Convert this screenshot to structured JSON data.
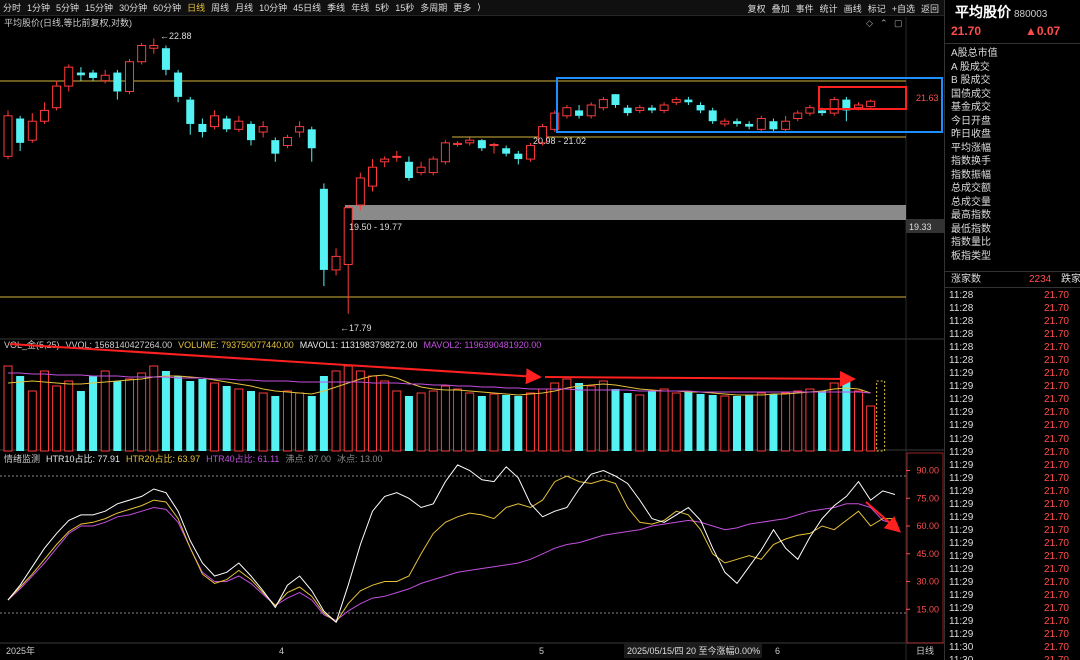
{
  "toolbar": {
    "periods": [
      "分时",
      "1分钟",
      "5分钟",
      "15分钟",
      "30分钟",
      "60分钟",
      "日线",
      "周线",
      "月线",
      "10分钟",
      "45日线",
      "季线",
      "年线",
      "5秒",
      "15秒",
      "多周期",
      "更多"
    ],
    "active_period": "日线",
    "right_items": [
      "复权",
      "叠加",
      "事件",
      "统计",
      "画线",
      "标记",
      "+自选",
      "返回"
    ]
  },
  "main_chart": {
    "title": "平均股价(日线,等比前复权,对数)",
    "labels": {
      "high": "22.88",
      "low": "17.79",
      "zone1": "20.98 - 21.02",
      "zone2": "19.50 - 19.77",
      "right_price1": "21.63",
      "right_price2": "19.33"
    }
  },
  "volume_panel": {
    "title": "VOL_金(5,25)",
    "vvol": "VVOL: 1568140427264.00",
    "volume": "VOLUME: 793750077440.00",
    "mavol1": "MAVOL1: 1131983798272.00",
    "mavol2": "MAVOL2: 1196390481920.00"
  },
  "sentiment_panel": {
    "title": "情绪监测",
    "htr10": "HTR10占比: 77.91",
    "htr20": "HTR20占比: 63.97",
    "htr40": "HTR40占比: 61.11",
    "boil": "沸点: 87.00",
    "freeze": "冰点: 13.00",
    "axis": [
      "90.00",
      "75.00",
      "60.00",
      "45.00",
      "30.00",
      "15.00"
    ]
  },
  "bottom_axis": {
    "labels": [
      "2025年",
      "4",
      "5",
      "6"
    ],
    "status": "2025/05/15/四 20 至今涨幅0.00%",
    "period": "日线"
  },
  "right_panel": {
    "name": "平均股价",
    "code": "880003",
    "price": "21.70",
    "change": "▲0.07",
    "fields": [
      "A股总市值",
      "A 股成交",
      "B 股成交",
      "国债成交",
      "基金成交",
      "今日开盘",
      "昨日收盘",
      "平均涨幅",
      "指数换手",
      "指数振幅",
      "总成交额",
      "总成交量",
      "最高指数",
      "最低指数",
      "指数量比",
      "板指类型"
    ],
    "up_label": "涨家数",
    "up_count": "2234",
    "down_label": "跌家",
    "ticks": [
      {
        "time": "11:28",
        "price": "21.70"
      },
      {
        "time": "11:28",
        "price": "21.70"
      },
      {
        "time": "11:28",
        "price": "21.70"
      },
      {
        "time": "11:28",
        "price": "21.70"
      },
      {
        "time": "11:28",
        "price": "21.70"
      },
      {
        "time": "11:28",
        "price": "21.70"
      },
      {
        "time": "11:29",
        "price": "21.70"
      },
      {
        "time": "11:29",
        "price": "21.70"
      },
      {
        "time": "11:29",
        "price": "21.70"
      },
      {
        "time": "11:29",
        "price": "21.70"
      },
      {
        "time": "11:29",
        "price": "21.70"
      },
      {
        "time": "11:29",
        "price": "21.70"
      },
      {
        "time": "11:29",
        "price": "21.70"
      },
      {
        "time": "11:29",
        "price": "21.70"
      },
      {
        "time": "11:29",
        "price": "21.70"
      },
      {
        "time": "11:29",
        "price": "21.70"
      },
      {
        "time": "11:29",
        "price": "21.70"
      },
      {
        "time": "11:29",
        "price": "21.70"
      },
      {
        "time": "11:29",
        "price": "21.70"
      },
      {
        "time": "11:29",
        "price": "21.70"
      },
      {
        "time": "11:29",
        "price": "21.70"
      },
      {
        "time": "11:29",
        "price": "21.70"
      },
      {
        "time": "11:29",
        "price": "21.70"
      },
      {
        "time": "11:29",
        "price": "21.70"
      },
      {
        "time": "11:29",
        "price": "21.70"
      },
      {
        "time": "11:29",
        "price": "21.70"
      },
      {
        "time": "11:29",
        "price": "21.70"
      },
      {
        "time": "11:30",
        "price": "21.70"
      },
      {
        "time": "11:30",
        "price": "21.70"
      },
      {
        "time": "11:30",
        "price": "21.70"
      }
    ]
  },
  "colors": {
    "up": "#ff3b3b",
    "down": "#54f2f2",
    "mavol1": "#e6c13a",
    "mavol2": "#c34fe0",
    "htr10": "#ffffff",
    "htr20": "#e6c13a",
    "htr40": "#c34fe0",
    "highlight_blue": "#1e8fff",
    "highlight_red": "#ff2020"
  },
  "chart_data": {
    "type": "candlestick",
    "candles": [
      {
        "o": 20.7,
        "c": 21.45,
        "h": 21.55,
        "l": 20.65
      },
      {
        "o": 21.4,
        "c": 20.95,
        "h": 21.45,
        "l": 20.8
      },
      {
        "o": 21.0,
        "c": 21.35,
        "h": 21.5,
        "l": 20.95
      },
      {
        "o": 21.35,
        "c": 21.55,
        "h": 21.7,
        "l": 21.3
      },
      {
        "o": 21.6,
        "c": 22.0,
        "h": 22.1,
        "l": 21.55
      },
      {
        "o": 22.0,
        "c": 22.35,
        "h": 22.4,
        "l": 21.9
      },
      {
        "o": 22.25,
        "c": 22.2,
        "h": 22.35,
        "l": 22.1
      },
      {
        "o": 22.25,
        "c": 22.15,
        "h": 22.3,
        "l": 22.1
      },
      {
        "o": 22.1,
        "c": 22.2,
        "h": 22.3,
        "l": 22.05
      },
      {
        "o": 22.25,
        "c": 21.9,
        "h": 22.3,
        "l": 21.75
      },
      {
        "o": 21.9,
        "c": 22.45,
        "h": 22.5,
        "l": 21.85
      },
      {
        "o": 22.45,
        "c": 22.75,
        "h": 22.8,
        "l": 22.4
      },
      {
        "o": 22.7,
        "c": 22.75,
        "h": 22.88,
        "l": 22.6
      },
      {
        "o": 22.7,
        "c": 22.3,
        "h": 22.75,
        "l": 22.2
      },
      {
        "o": 22.25,
        "c": 21.8,
        "h": 22.3,
        "l": 21.7
      },
      {
        "o": 21.75,
        "c": 21.3,
        "h": 21.8,
        "l": 21.1
      },
      {
        "o": 21.3,
        "c": 21.15,
        "h": 21.4,
        "l": 21.05
      },
      {
        "o": 21.25,
        "c": 21.45,
        "h": 21.55,
        "l": 21.2
      },
      {
        "o": 21.4,
        "c": 21.2,
        "h": 21.45,
        "l": 21.15
      },
      {
        "o": 21.2,
        "c": 21.35,
        "h": 21.45,
        "l": 21.15
      },
      {
        "o": 21.3,
        "c": 21.0,
        "h": 21.35,
        "l": 20.9
      },
      {
        "o": 21.15,
        "c": 21.25,
        "h": 21.35,
        "l": 21.05
      },
      {
        "o": 21.0,
        "c": 20.75,
        "h": 21.05,
        "l": 20.6
      },
      {
        "o": 20.9,
        "c": 21.05,
        "h": 21.1,
        "l": 20.85
      },
      {
        "o": 21.15,
        "c": 21.25,
        "h": 21.35,
        "l": 21.05
      },
      {
        "o": 21.2,
        "c": 20.85,
        "h": 21.25,
        "l": 20.6
      },
      {
        "o": 20.1,
        "c": 18.6,
        "h": 20.2,
        "l": 18.3
      },
      {
        "o": 18.6,
        "c": 18.85,
        "h": 19.0,
        "l": 18.5
      },
      {
        "o": 18.7,
        "c": 19.75,
        "h": 19.8,
        "l": 17.79
      },
      {
        "o": 19.8,
        "c": 20.3,
        "h": 20.4,
        "l": 19.7
      },
      {
        "o": 20.15,
        "c": 20.5,
        "h": 20.65,
        "l": 20.05
      },
      {
        "o": 20.6,
        "c": 20.65,
        "h": 20.7,
        "l": 20.5
      },
      {
        "o": 20.7,
        "c": 20.7,
        "h": 20.8,
        "l": 20.6
      },
      {
        "o": 20.6,
        "c": 20.3,
        "h": 20.7,
        "l": 20.25
      },
      {
        "o": 20.4,
        "c": 20.5,
        "h": 20.6,
        "l": 20.35
      },
      {
        "o": 20.4,
        "c": 20.65,
        "h": 20.7,
        "l": 20.35
      },
      {
        "o": 20.6,
        "c": 20.95,
        "h": 21.0,
        "l": 20.55
      },
      {
        "o": 20.92,
        "c": 20.94,
        "h": 20.98,
        "l": 20.88
      },
      {
        "o": 20.95,
        "c": 21.0,
        "h": 21.05,
        "l": 20.9
      },
      {
        "o": 21.0,
        "c": 20.85,
        "h": 21.02,
        "l": 20.8
      },
      {
        "o": 20.9,
        "c": 20.92,
        "h": 20.95,
        "l": 20.75
      },
      {
        "o": 20.85,
        "c": 20.75,
        "h": 20.9,
        "l": 20.7
      },
      {
        "o": 20.75,
        "c": 20.65,
        "h": 20.8,
        "l": 20.55
      },
      {
        "o": 20.65,
        "c": 20.9,
        "h": 20.95,
        "l": 20.6
      },
      {
        "o": 20.95,
        "c": 21.25,
        "h": 21.3,
        "l": 20.9
      },
      {
        "o": 21.2,
        "c": 21.5,
        "h": 21.55,
        "l": 21.15
      },
      {
        "o": 21.45,
        "c": 21.6,
        "h": 21.65,
        "l": 21.4
      },
      {
        "o": 21.55,
        "c": 21.45,
        "h": 21.65,
        "l": 21.4
      },
      {
        "o": 21.45,
        "c": 21.65,
        "h": 21.7,
        "l": 21.4
      },
      {
        "o": 21.6,
        "c": 21.75,
        "h": 21.8,
        "l": 21.55
      },
      {
        "o": 21.85,
        "c": 21.65,
        "h": 21.85,
        "l": 21.6
      },
      {
        "o": 21.6,
        "c": 21.5,
        "h": 21.65,
        "l": 21.45
      },
      {
        "o": 21.55,
        "c": 21.6,
        "h": 21.65,
        "l": 21.5
      },
      {
        "o": 21.6,
        "c": 21.55,
        "h": 21.65,
        "l": 21.5
      },
      {
        "o": 21.55,
        "c": 21.65,
        "h": 21.7,
        "l": 21.5
      },
      {
        "o": 21.7,
        "c": 21.75,
        "h": 21.8,
        "l": 21.65
      },
      {
        "o": 21.75,
        "c": 21.7,
        "h": 21.8,
        "l": 21.65
      },
      {
        "o": 21.65,
        "c": 21.55,
        "h": 21.7,
        "l": 21.5
      },
      {
        "o": 21.55,
        "c": 21.35,
        "h": 21.6,
        "l": 21.3
      },
      {
        "o": 21.3,
        "c": 21.35,
        "h": 21.4,
        "l": 21.25
      },
      {
        "o": 21.35,
        "c": 21.3,
        "h": 21.4,
        "l": 21.25
      },
      {
        "o": 21.3,
        "c": 21.25,
        "h": 21.35,
        "l": 21.2
      },
      {
        "o": 21.2,
        "c": 21.4,
        "h": 21.45,
        "l": 21.15
      },
      {
        "o": 21.35,
        "c": 21.2,
        "h": 21.4,
        "l": 21.15
      },
      {
        "o": 21.2,
        "c": 21.35,
        "h": 21.45,
        "l": 21.15
      },
      {
        "o": 21.4,
        "c": 21.5,
        "h": 21.55,
        "l": 21.35
      },
      {
        "o": 21.5,
        "c": 21.6,
        "h": 21.65,
        "l": 21.45
      },
      {
        "o": 21.55,
        "c": 21.5,
        "h": 21.6,
        "l": 21.45
      },
      {
        "o": 21.5,
        "c": 21.75,
        "h": 21.8,
        "l": 21.45
      },
      {
        "o": 21.75,
        "c": 21.55,
        "h": 21.8,
        "l": 21.35
      },
      {
        "o": 21.6,
        "c": 21.65,
        "h": 21.7,
        "l": 21.55
      },
      {
        "o": 21.62,
        "c": 21.72,
        "h": 21.75,
        "l": 21.6
      }
    ],
    "volume": [
      85,
      75,
      60,
      80,
      65,
      70,
      60,
      75,
      80,
      70,
      72,
      78,
      85,
      80,
      75,
      70,
      72,
      68,
      65,
      62,
      60,
      58,
      55,
      60,
      58,
      55,
      75,
      80,
      85,
      80,
      75,
      70,
      60,
      55,
      58,
      60,
      65,
      62,
      58,
      55,
      57,
      56,
      55,
      58,
      62,
      68,
      72,
      68,
      65,
      70,
      62,
      58,
      56,
      60,
      62,
      58,
      60,
      57,
      56,
      55,
      55,
      56,
      58,
      57,
      58,
      60,
      62,
      60,
      68,
      70,
      60,
      45
    ],
    "mavol1": [
      68,
      69,
      70,
      69,
      68,
      67,
      67,
      68,
      69,
      70,
      71,
      72,
      74,
      75,
      75,
      74,
      73,
      71,
      69,
      67,
      65,
      62,
      60,
      59,
      58,
      57,
      60,
      64,
      68,
      72,
      75,
      76,
      73,
      68,
      64,
      62,
      61,
      61,
      60,
      59,
      58,
      57,
      56,
      57,
      58,
      60,
      63,
      65,
      66,
      67,
      66,
      64,
      62,
      61,
      60,
      60,
      59,
      59,
      58,
      57,
      56,
      56,
      56,
      57,
      57,
      58,
      59,
      60,
      62,
      63,
      62,
      58
    ],
    "mavol2": [
      78,
      78,
      77,
      77,
      76,
      76,
      76,
      75,
      75,
      75,
      74,
      74,
      74,
      74,
      73,
      73,
      73,
      72,
      72,
      71,
      71,
      70,
      70,
      70,
      69,
      69,
      69,
      69,
      69,
      69,
      68,
      68,
      68,
      67,
      67,
      66,
      66,
      65,
      65,
      64,
      64,
      63,
      63,
      62,
      62,
      62,
      62,
      61,
      61,
      61,
      61,
      61,
      60,
      60,
      60,
      60,
      60,
      59,
      59,
      59,
      59,
      59,
      59,
      59,
      59,
      59,
      59,
      59,
      59,
      59,
      59,
      58
    ],
    "htr10": [
      20,
      28,
      38,
      48,
      56,
      63,
      66,
      66,
      68,
      72,
      74,
      76,
      80,
      78,
      68,
      52,
      40,
      33,
      35,
      40,
      33,
      25,
      16,
      28,
      33,
      25,
      14,
      8,
      28,
      50,
      68,
      76,
      78,
      75,
      70,
      72,
      84,
      93,
      90,
      85,
      84,
      92,
      86,
      72,
      65,
      68,
      70,
      80,
      88,
      90,
      87,
      83,
      74,
      64,
      62,
      66,
      70,
      63,
      48,
      35,
      29,
      38,
      47,
      58,
      48,
      42,
      54,
      64,
      71,
      76,
      84,
      74,
      79,
      77
    ],
    "htr20": [
      20,
      27,
      34,
      42,
      50,
      57,
      61,
      62,
      64,
      67,
      69,
      71,
      74,
      73,
      64,
      48,
      34,
      29,
      31,
      36,
      31,
      24,
      17,
      24,
      27,
      22,
      13,
      8,
      18,
      25,
      28,
      30,
      30,
      33,
      45,
      56,
      62,
      65,
      67,
      66,
      64,
      70,
      72,
      70,
      74,
      84,
      87,
      84,
      83,
      85,
      83,
      70,
      62,
      61,
      63,
      68,
      66,
      58,
      45,
      40,
      42,
      44,
      42,
      50,
      53,
      55,
      56,
      60,
      58,
      63,
      68,
      60,
      64,
      64
    ],
    "htr40": [
      20,
      26,
      33,
      40,
      48,
      56,
      60,
      60,
      62,
      65,
      66,
      68,
      70,
      69,
      62,
      48,
      35,
      30,
      30,
      33,
      29,
      23,
      17,
      21,
      24,
      20,
      12,
      9,
      14,
      18,
      21,
      22,
      24,
      26,
      29,
      31,
      33,
      35,
      36,
      37,
      38,
      39,
      40,
      42,
      45,
      48,
      50,
      51,
      53,
      55,
      56,
      57,
      58,
      60,
      61,
      62,
      63,
      62,
      60,
      58,
      59,
      61,
      62,
      63,
      64,
      66,
      68,
      69,
      70,
      72,
      72,
      70,
      63,
      61
    ]
  }
}
